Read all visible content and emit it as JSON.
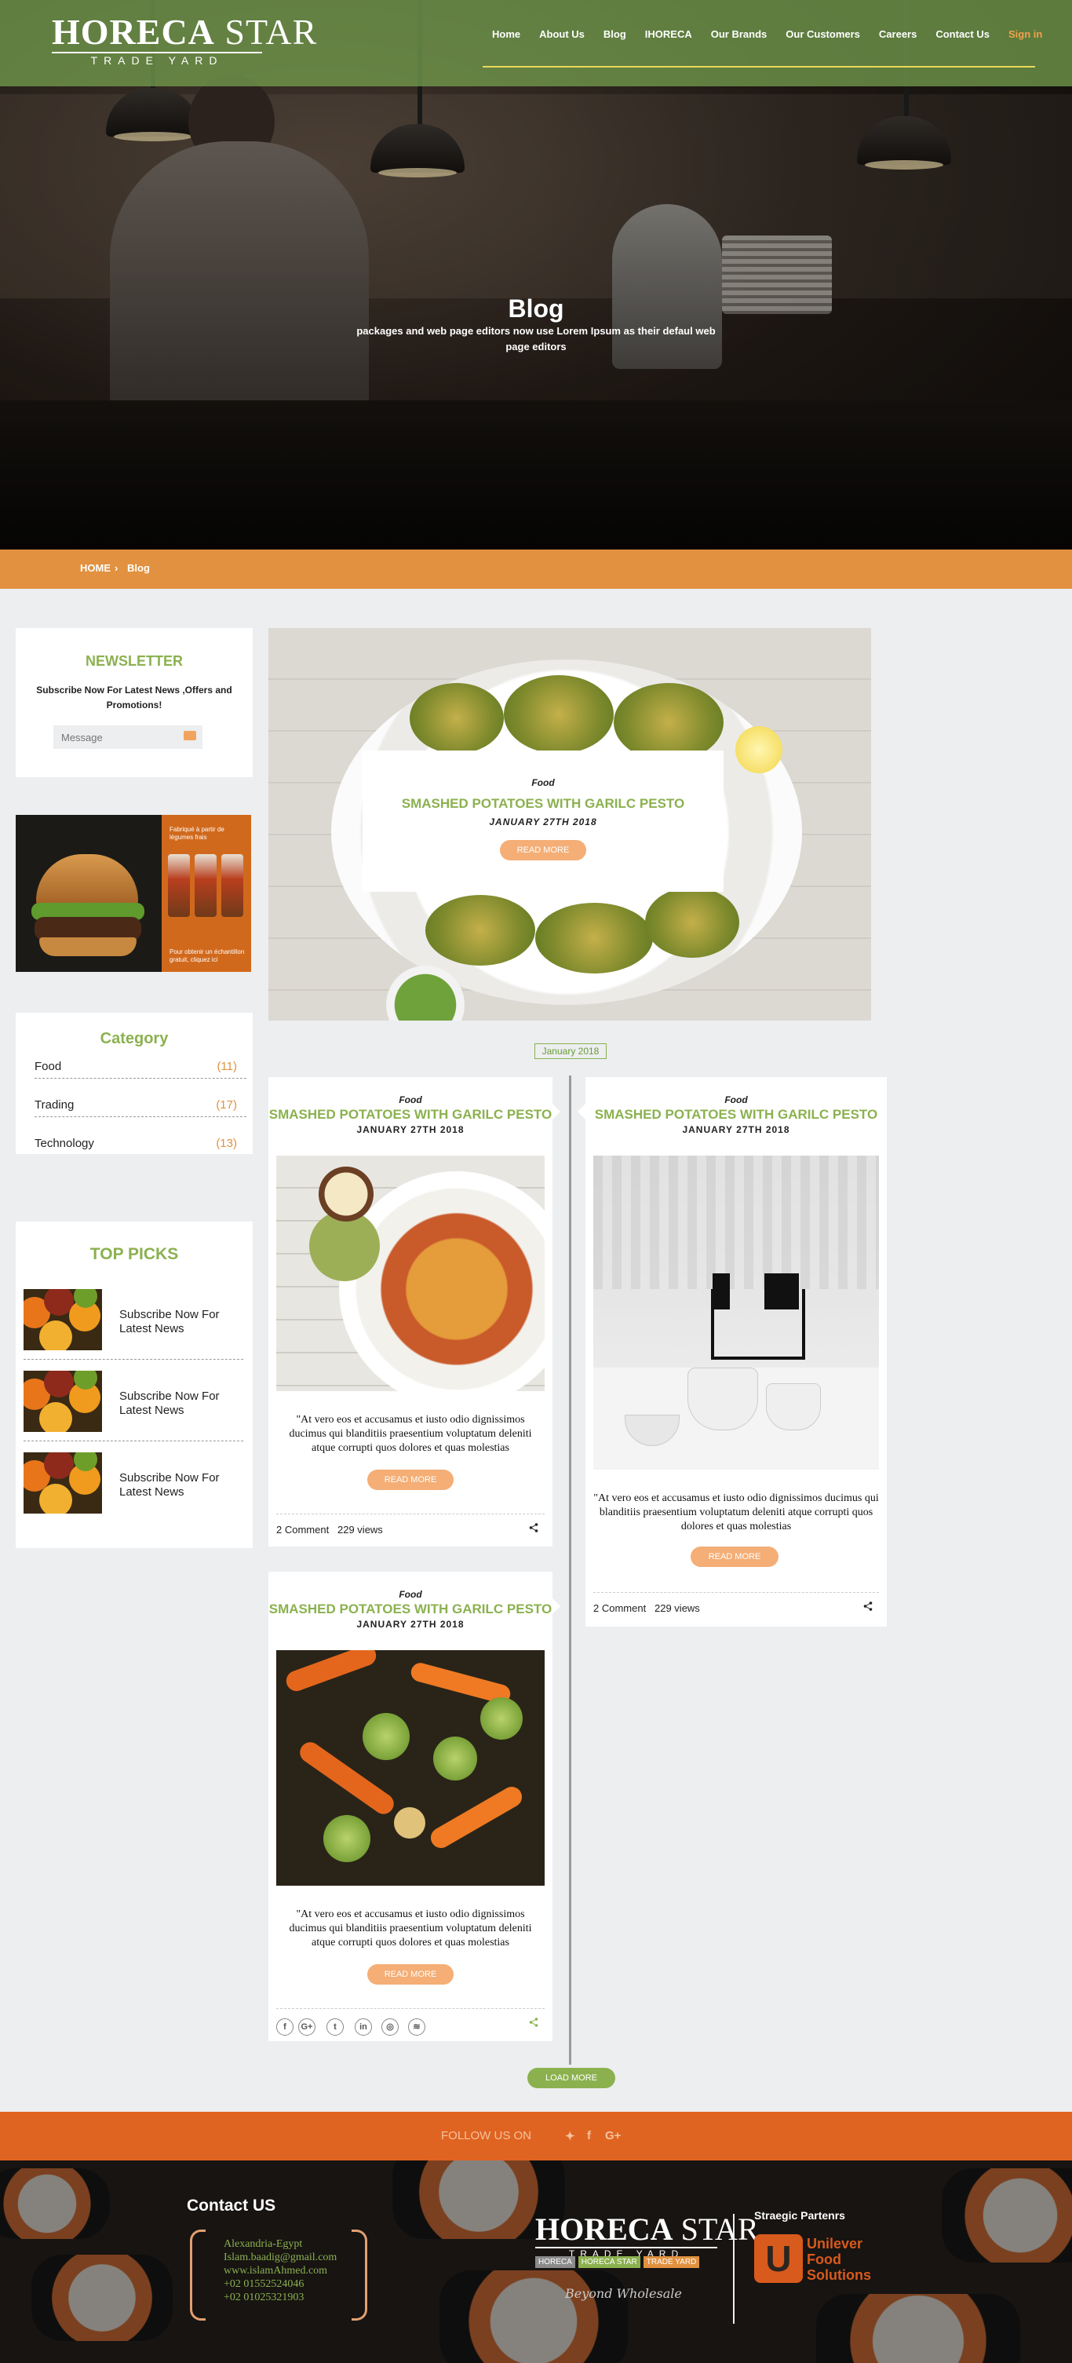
{
  "brand": {
    "name_a": "HORECA",
    "name_b": "STAR",
    "tagline": "TRADE YARD"
  },
  "nav": {
    "items": [
      "Home",
      "About Us",
      "Blog",
      "IHORECA",
      "Our Brands",
      "Our Customers",
      "Careers",
      "Contact Us"
    ],
    "signin": "Sign in"
  },
  "hero": {
    "title": "Blog",
    "subtitle": "packages and web page editors now use Lorem Ipsum as their defaul web page editors"
  },
  "breadcrumb": {
    "home": "HOME",
    "sep": "›",
    "current": "Blog"
  },
  "newsletter": {
    "title": "NEWSLETTER",
    "text": "Subscribe Now For Latest News ,Offers and Promotions!",
    "placeholder": "Message"
  },
  "ad": {
    "top_text": "Fabriqué à partir de légumes frais",
    "bottom_text": "Pour obtenir un échantillon gratuit, cliquez ici"
  },
  "category": {
    "title": "Category",
    "items": [
      {
        "name": "Food",
        "count": "(11)"
      },
      {
        "name": "Trading",
        "count": "(17)"
      },
      {
        "name": "Technology",
        "count": "(13)"
      }
    ]
  },
  "top_picks": {
    "title": "TOP PICKS",
    "items": [
      "Subscribe Now For Latest News",
      "Subscribe Now For Latest News",
      "Subscribe Now For Latest News"
    ]
  },
  "featured": {
    "category": "Food",
    "title": "SMASHED POTATOES WITH GARILC PESTO",
    "date": "JANUARY 27TH 2018",
    "button": "READ MORE"
  },
  "timeline": {
    "month": "January 2018"
  },
  "posts": [
    {
      "category": "Food",
      "title": "SMASHED POTATOES WITH GARILC PESTO",
      "date": "JANUARY 27TH 2018",
      "text": "\"At vero eos et accusamus et iusto odio dignissimos ducimus qui blanditiis praesentium voluptatum deleniti atque corrupti quos dolores et quas molestias",
      "button": "READ MORE",
      "comments": "2 Comment",
      "views": "229 views"
    },
    {
      "category": "Food",
      "title": "SMASHED POTATOES WITH GARILC PESTO",
      "date": "JANUARY 27TH 2018",
      "text": "\"At vero eos et accusamus et iusto odio dignissimos ducimus qui blanditiis praesentium voluptatum deleniti atque corrupti quos dolores et quas molestias",
      "button": "READ MORE",
      "comments": "2 Comment",
      "views": "229 views"
    },
    {
      "category": "Food",
      "title": "SMASHED POTATOES WITH GARILC PESTO",
      "date": "JANUARY 27TH 2018",
      "text": "\"At vero eos et accusamus et iusto odio dignissimos ducimus qui blanditiis praesentium voluptatum deleniti atque corrupti quos dolores et quas molestias",
      "button": "READ MORE"
    }
  ],
  "social_icons": [
    "facebook-icon",
    "google-plus-icon",
    "twitter-icon",
    "linkedin-icon",
    "instagram-icon",
    "wifi-icon"
  ],
  "load_more": "LOAD MORE",
  "follow": {
    "label": "FOLLOW US ON"
  },
  "footer": {
    "contact_title": "Contact US",
    "contact_lines": [
      "Alexandria-Egypt",
      "Islam.baadig@gmail.com",
      "www.islamAhmed.com",
      "+02 01552524046",
      "+02 01025321903"
    ],
    "tags": [
      "HORECA",
      "HORECA STAR",
      "TRADE YARD"
    ],
    "slogan": "Beyond Wholesale",
    "partners_title": "Straegic Partenrs",
    "partner_name": "Unilever Food Solutions"
  },
  "colors": {
    "green": "#8bb14f",
    "orange": "#e1913f",
    "follow_bar": "#e06421",
    "pill": "#f4ae76"
  }
}
